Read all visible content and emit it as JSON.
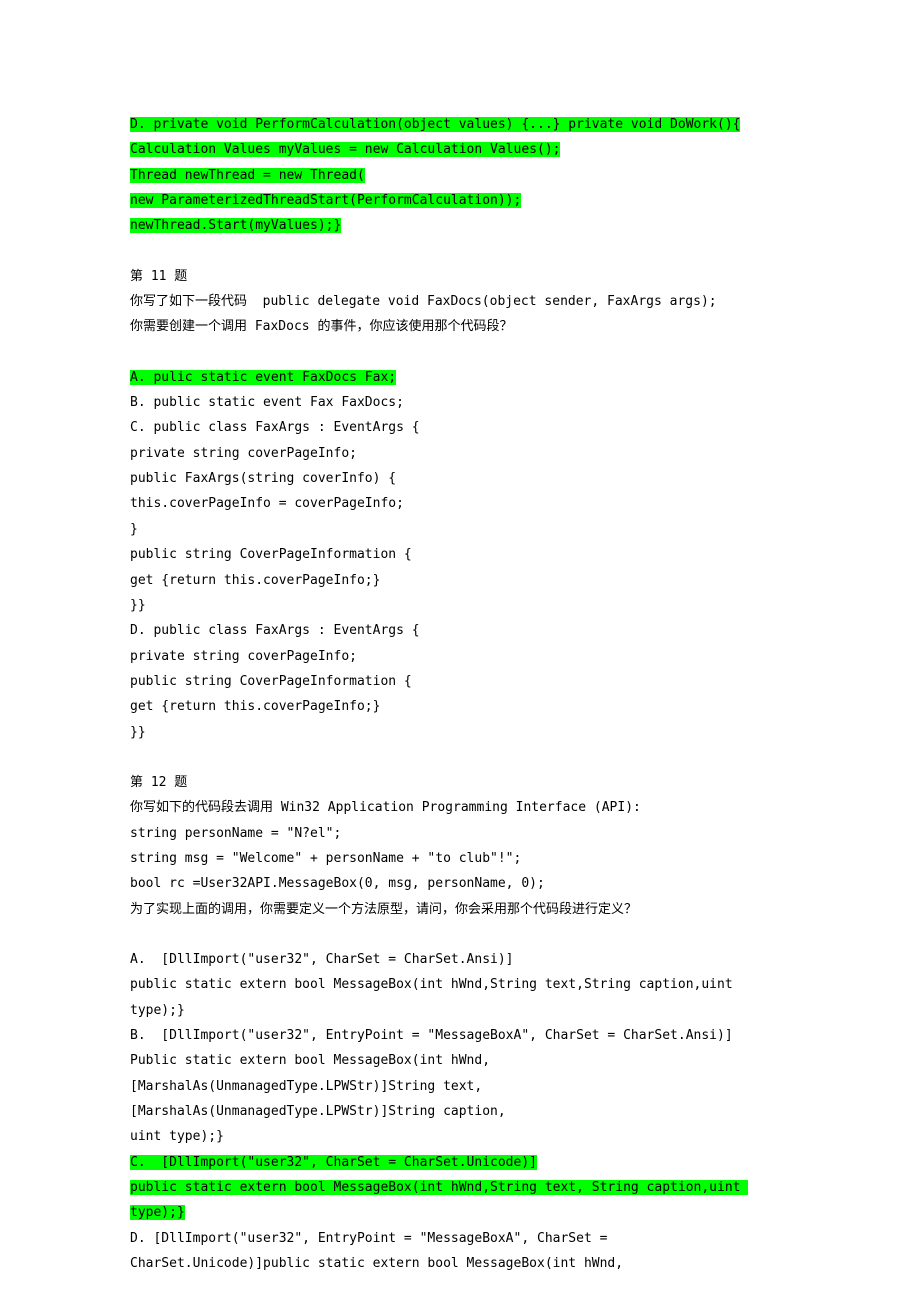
{
  "lines": [
    {
      "text": "D. private void PerformCalculation(object values) {...} private void DoWork(){",
      "highlight": true
    },
    {
      "text": "Calculation Values myValues = new Calculation Values();",
      "highlight": true
    },
    {
      "text": "Thread newThread = new Thread(",
      "highlight": true
    },
    {
      "text": "new ParameterizedThreadStart(PerformCalculation));",
      "highlight": true
    },
    {
      "text": "newThread.Start(myValues);}",
      "highlight": true
    },
    {
      "blank": true
    },
    {
      "text": "第 11 题",
      "highlight": false
    },
    {
      "text": "你写了如下一段代码  public delegate void FaxDocs(object sender, FaxArgs args);",
      "highlight": false
    },
    {
      "text": "你需要创建一个调用 FaxDocs 的事件，你应该使用那个代码段？",
      "highlight": false
    },
    {
      "blank": true
    },
    {
      "text": "A. pulic static event FaxDocs Fax;",
      "highlight": true
    },
    {
      "text": "B. public static event Fax FaxDocs;",
      "highlight": false
    },
    {
      "text": "C. public class FaxArgs : EventArgs {",
      "highlight": false
    },
    {
      "text": "private string coverPageInfo;",
      "highlight": false
    },
    {
      "text": "public FaxArgs(string coverInfo) {",
      "highlight": false
    },
    {
      "text": "this.coverPageInfo = coverPageInfo;",
      "highlight": false
    },
    {
      "text": "}",
      "highlight": false
    },
    {
      "text": "public string CoverPageInformation {",
      "highlight": false
    },
    {
      "text": "get {return this.coverPageInfo;}",
      "highlight": false
    },
    {
      "text": "}}",
      "highlight": false
    },
    {
      "text": "D. public class FaxArgs : EventArgs {",
      "highlight": false
    },
    {
      "text": "private string coverPageInfo;",
      "highlight": false
    },
    {
      "text": "public string CoverPageInformation {",
      "highlight": false
    },
    {
      "text": "get {return this.coverPageInfo;}",
      "highlight": false
    },
    {
      "text": "}}",
      "highlight": false
    },
    {
      "blank": true
    },
    {
      "text": "第 12 题",
      "highlight": false
    },
    {
      "text": "你写如下的代码段去调用 Win32 Application Programming Interface (API):",
      "highlight": false
    },
    {
      "text": "string personName = \"N?el\";",
      "highlight": false
    },
    {
      "text": "string msg = \"Welcome\" + personName + \"to club\"!\";",
      "highlight": false
    },
    {
      "text": "bool rc =User32API.MessageBox(0, msg, personName, 0);",
      "highlight": false
    },
    {
      "text": "为了实现上面的调用，你需要定义一个方法原型，请问，你会采用那个代码段进行定义？",
      "highlight": false
    },
    {
      "blank": true
    },
    {
      "text": "A.  [DllImport(\"user32\", CharSet = CharSet.Ansi)]",
      "highlight": false
    },
    {
      "text": "public static extern bool MessageBox(int hWnd,String text,String caption,uint type);}",
      "highlight": false
    },
    {
      "text": "B.  [DllImport(\"user32\", EntryPoint = \"MessageBoxA\", CharSet = CharSet.Ansi)]",
      "highlight": false
    },
    {
      "text": "Public static extern bool MessageBox(int hWnd,",
      "highlight": false
    },
    {
      "text": "[MarshalAs(UnmanagedType.LPWStr)]String text,",
      "highlight": false
    },
    {
      "text": "[MarshalAs(UnmanagedType.LPWStr)]String caption,",
      "highlight": false
    },
    {
      "text": "uint type);}",
      "highlight": false
    },
    {
      "text": "C.  [DllImport(\"user32\", CharSet = CharSet.Unicode)]",
      "highlight": true
    },
    {
      "text": "public static extern bool MessageBox(int hWnd,String text, String caption,uint type);}",
      "highlight": true
    },
    {
      "text": "D. [DllImport(\"user32\", EntryPoint = \"MessageBoxA\", CharSet =",
      "highlight": false
    },
    {
      "text": "CharSet.Unicode)]public static extern bool MessageBox(int hWnd,",
      "highlight": false
    }
  ]
}
